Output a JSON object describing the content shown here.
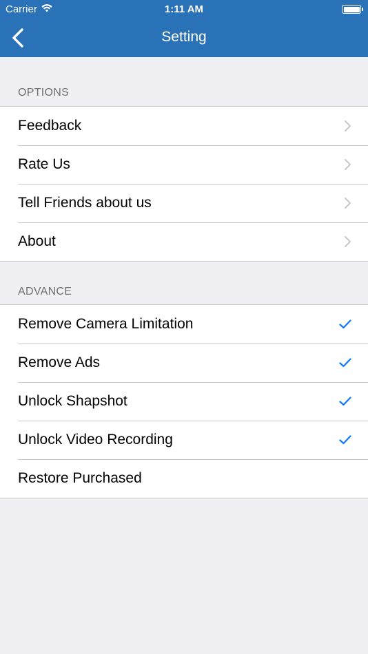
{
  "status_bar": {
    "carrier": "Carrier",
    "time": "1:11 AM"
  },
  "nav": {
    "title": "Setting",
    "back_icon": "chevron-left-icon"
  },
  "sections": [
    {
      "header": "OPTIONS",
      "items": [
        {
          "label": "Feedback",
          "accessory": "chevron-right-icon"
        },
        {
          "label": "Rate Us",
          "accessory": "chevron-right-icon"
        },
        {
          "label": "Tell Friends about us",
          "accessory": "chevron-right-icon"
        },
        {
          "label": "About",
          "accessory": "chevron-right-icon"
        }
      ]
    },
    {
      "header": "ADVANCE",
      "items": [
        {
          "label": "Remove Camera Limitation",
          "accessory": "checkmark-icon",
          "checked": true
        },
        {
          "label": "Remove Ads",
          "accessory": "checkmark-icon",
          "checked": true
        },
        {
          "label": "Unlock Shapshot",
          "accessory": "checkmark-icon",
          "checked": true
        },
        {
          "label": "Unlock Video Recording",
          "accessory": "checkmark-icon",
          "checked": true
        },
        {
          "label": "Restore Purchased",
          "accessory": "none",
          "checked": false
        }
      ]
    }
  ],
  "colors": {
    "nav_background": "#2a72b8",
    "page_background": "#efeff4",
    "checkmark": "#0a7aff",
    "chevron": "#c7c7cc",
    "section_header_text": "#6d6d72"
  }
}
